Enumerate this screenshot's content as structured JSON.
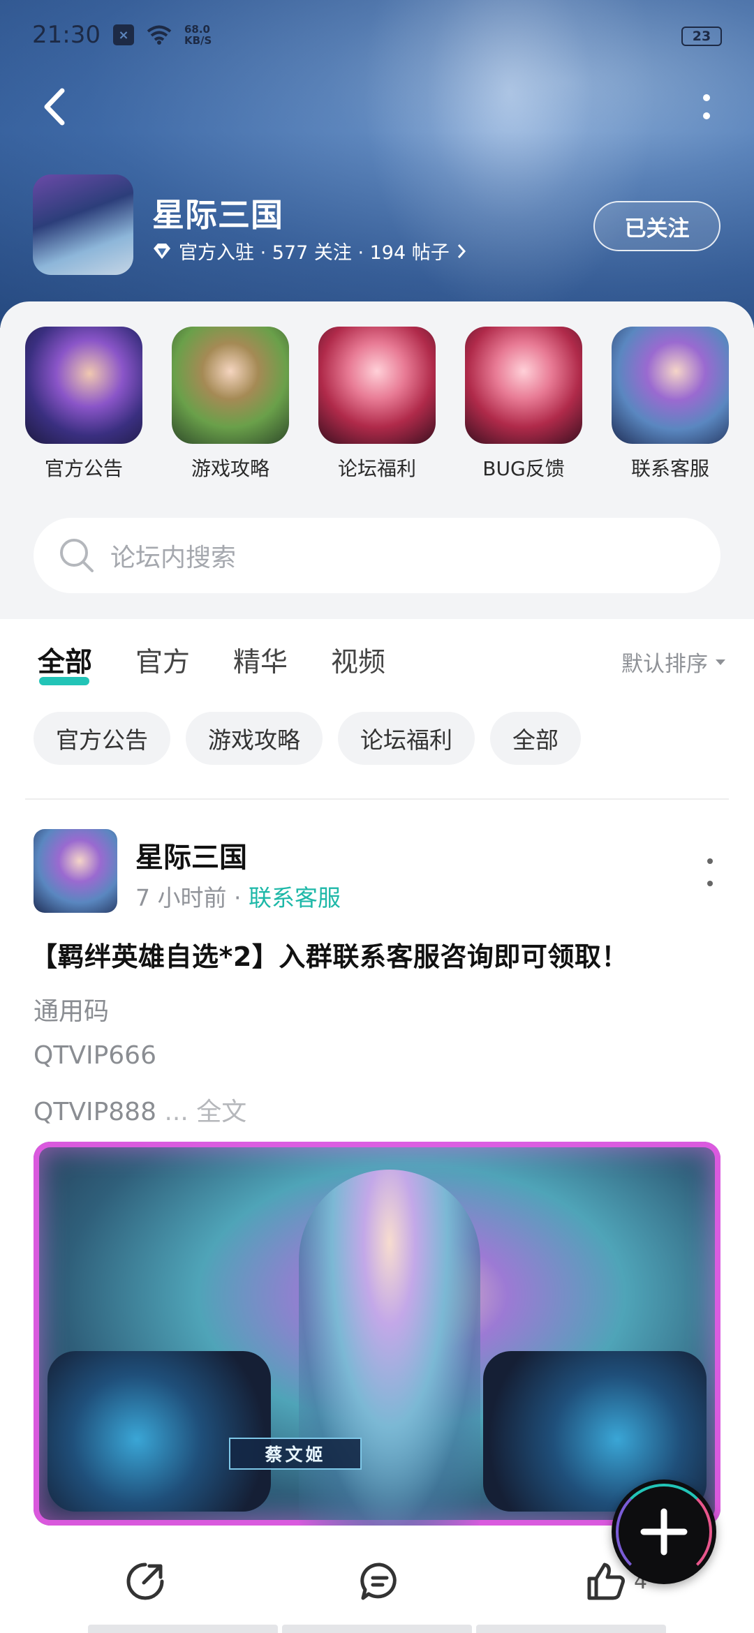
{
  "status_bar": {
    "time": "21:30",
    "speed_value": "68.0",
    "speed_unit": "KB/S",
    "battery": "23"
  },
  "forum": {
    "name": "星际三国",
    "meta": "官方入驻 · 577 关注 · 194 帖子",
    "follow_label": "已关注"
  },
  "categories": [
    {
      "label": "官方公告"
    },
    {
      "label": "游戏攻略"
    },
    {
      "label": "论坛福利"
    },
    {
      "label": "BUG反馈"
    },
    {
      "label": "联系客服"
    }
  ],
  "search": {
    "placeholder": "论坛内搜索"
  },
  "tabs": [
    {
      "label": "全部",
      "active": true
    },
    {
      "label": "官方"
    },
    {
      "label": "精华"
    },
    {
      "label": "视频"
    }
  ],
  "sort_label": "默认排序",
  "chips": [
    "官方公告",
    "游戏攻略",
    "论坛福利",
    "全部"
  ],
  "post": {
    "author": "星际三国",
    "time": "7 小时前",
    "separator": " · ",
    "tag": "联系客服",
    "title": "【羁绊英雄自选*2】入群联系客服咨询即可领取！",
    "lines": [
      "通用码",
      "QTVIP666",
      "QTVIP888"
    ],
    "ellipsis": " ... ",
    "more_label": "全文",
    "image_caption": "蔡文姬",
    "like_count": "4"
  },
  "colors": {
    "accent": "#22c4b7",
    "tag": "#1eb8a8"
  }
}
